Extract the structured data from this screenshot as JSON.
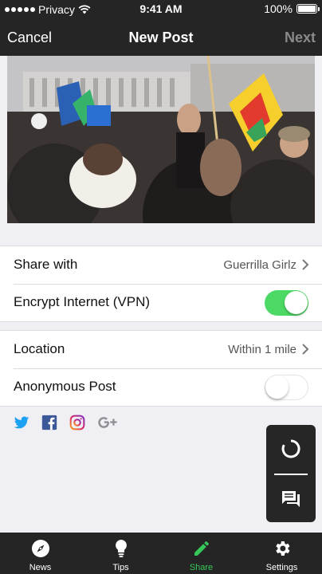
{
  "status_bar": {
    "carrier": "Privacy",
    "time": "9:41 AM",
    "battery": "100%"
  },
  "nav": {
    "cancel_label": "Cancel",
    "title": "New Post",
    "next_label": "Next"
  },
  "settings": {
    "share_with": {
      "label": "Share with",
      "value": "Guerrilla Girlz"
    },
    "vpn": {
      "label": "Encrypt Internet (VPN)",
      "enabled": true
    },
    "location": {
      "label": "Location",
      "value": "Within 1 mile"
    },
    "anonymous": {
      "label": "Anonymous Post",
      "enabled": false
    }
  },
  "social_icons": [
    "twitter-icon",
    "facebook-icon",
    "instagram-icon",
    "google-plus-icon"
  ],
  "fab": [
    "refresh-icon",
    "chat-icon"
  ],
  "tabs": [
    {
      "label": "News",
      "icon": "compass-icon"
    },
    {
      "label": "Tips",
      "icon": "lightbulb-icon"
    },
    {
      "label": "Share",
      "icon": "pencil-icon",
      "active": true
    },
    {
      "label": "Settings",
      "icon": "gear-icon"
    }
  ],
  "colors": {
    "accent": "#35c759",
    "toggle_on": "#4cd964",
    "bar": "#252525",
    "twitter": "#1da1f2",
    "facebook": "#3b5998",
    "google": "#8e8e93"
  }
}
